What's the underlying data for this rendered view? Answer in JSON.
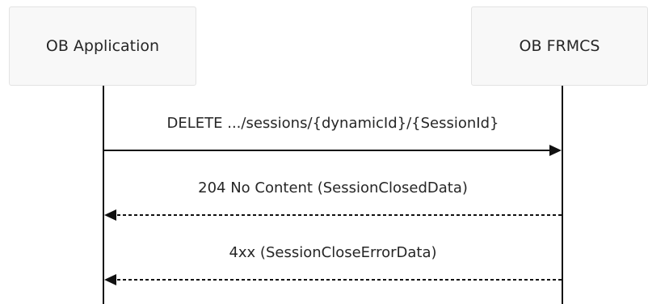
{
  "participants": {
    "left": "OB Application",
    "right": "OB FRMCS"
  },
  "messages": [
    {
      "label": "DELETE .../sessions/{dynamicId}/{SessionId}",
      "direction": "right",
      "style": "solid"
    },
    {
      "label": "204 No Content (SessionClosedData)",
      "direction": "left",
      "style": "dashed"
    },
    {
      "label": "4xx (SessionCloseErrorData)",
      "direction": "left",
      "style": "dashed"
    }
  ],
  "colors": {
    "line": "#111111",
    "box_fill": "#f8f8f8",
    "box_border": "#e3e3e3"
  }
}
